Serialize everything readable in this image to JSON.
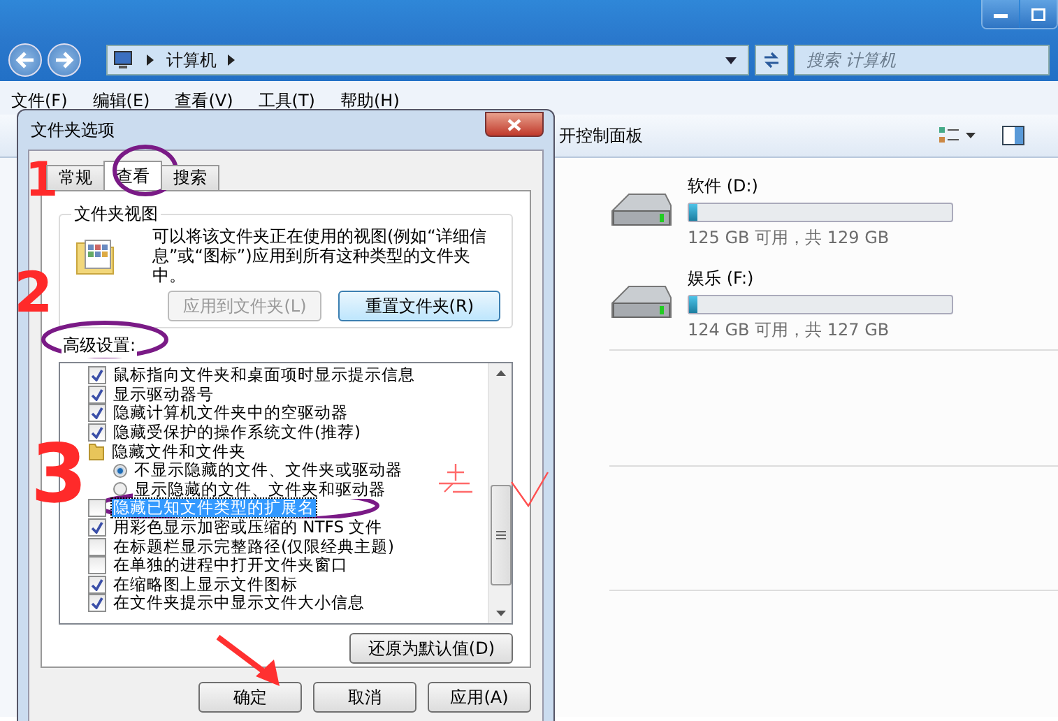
{
  "explorer": {
    "address": {
      "crumbs": [
        "计算机"
      ]
    },
    "search": {
      "placeholder": "搜索 计算机"
    },
    "menu": [
      "文件(F)",
      "编辑(E)",
      "查看(V)",
      "工具(T)",
      "帮助(H)"
    ],
    "toolbar": {
      "label": "开控制面板"
    },
    "drives": [
      {
        "name": "软件 (D:)",
        "level": 0.03,
        "info": "125 GB 可用，共 129 GB"
      },
      {
        "name": "娱乐 (F:)",
        "level": 0.03,
        "info": "124 GB 可用，共 127 GB"
      }
    ]
  },
  "dialog": {
    "title": "文件夹选项",
    "tabs": [
      {
        "label": "常规",
        "selected": false
      },
      {
        "label": "查看",
        "selected": true
      },
      {
        "label": "搜索",
        "selected": false
      }
    ],
    "folder_views": {
      "title": "文件夹视图",
      "text": "可以将该文件夹正在使用的视图(例如“详细信息”或“图标”)应用到所有这种类型的文件夹中。",
      "buttons": [
        {
          "label": "应用到文件夹(L)",
          "disabled": true
        },
        {
          "label": "重置文件夹(R)",
          "disabled": false
        }
      ]
    },
    "advanced": {
      "title": "高级设置:",
      "items": [
        {
          "kind": "checkbox",
          "label": "鼠标指向文件夹和桌面项时显示提示信息",
          "checked": true,
          "selected": false
        },
        {
          "kind": "checkbox",
          "label": "显示驱动器号",
          "checked": true,
          "selected": false
        },
        {
          "kind": "checkbox",
          "label": "隐藏计算机文件夹中的空驱动器",
          "checked": true,
          "selected": false
        },
        {
          "kind": "checkbox",
          "label": "隐藏受保护的操作系统文件(推荐)",
          "checked": true,
          "selected": false
        },
        {
          "kind": "folder",
          "label": "隐藏文件和文件夹",
          "children": [
            {
              "kind": "radio",
              "label": "不显示隐藏的文件、文件夹或驱动器",
              "checked": true,
              "selected": false
            },
            {
              "kind": "radio",
              "label": "显示隐藏的文件、文件夹和驱动器",
              "checked": false,
              "selected": false
            }
          ]
        },
        {
          "kind": "checkbox",
          "label": "隐藏已知文件类型的扩展名",
          "checked": false,
          "selected": true
        },
        {
          "kind": "checkbox",
          "label": "用彩色显示加密或压缩的 NTFS 文件",
          "checked": true,
          "selected": false
        },
        {
          "kind": "checkbox",
          "label": "在标题栏显示完整路径(仅限经典主题)",
          "checked": false,
          "selected": false
        },
        {
          "kind": "checkbox",
          "label": "在单独的进程中打开文件夹窗口",
          "checked": false,
          "selected": false
        },
        {
          "kind": "checkbox",
          "label": "在缩略图上显示文件图标",
          "checked": true,
          "selected": false
        },
        {
          "kind": "checkbox",
          "label": "在文件夹提示中显示文件大小信息",
          "checked": true,
          "selected": false
        }
      ],
      "restore_button": "还原为默认值(D)"
    },
    "buttons": [
      "确定",
      "取消",
      "应用(A)"
    ]
  },
  "annotations": [
    "1",
    "2",
    "3"
  ]
}
